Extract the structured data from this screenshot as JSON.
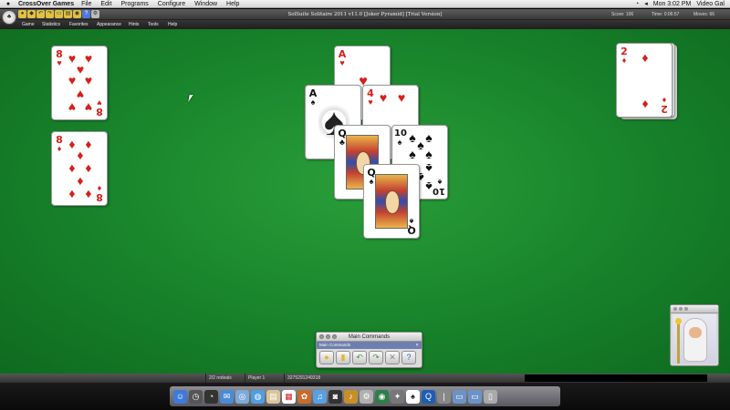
{
  "menubar": {
    "apple": "",
    "app_name": "CrossOver Games",
    "items": [
      "File",
      "Edit",
      "Programs",
      "Configure",
      "Window",
      "Help"
    ],
    "clock": "Mon 3:02 PM",
    "user": "Video Gal"
  },
  "titlebar": {
    "title": "SolSuite Solitaire 2011 v11.0 [Joker Pyramid] [Trial Version]",
    "score": "Score: 106",
    "time": "Time: 0:06:57",
    "moves": "Moves: 66"
  },
  "game_menu": [
    "Game",
    "Statistics",
    "Favorites",
    "Appearance",
    "Hints",
    "Tools",
    "Help"
  ],
  "cards": {
    "eight_hearts": {
      "rank": "8",
      "suit": "♥"
    },
    "eight_diamonds": {
      "rank": "8",
      "suit": "♦"
    },
    "ace_hearts": {
      "rank": "A",
      "suit": "♥"
    },
    "ace_spades": {
      "rank": "A",
      "suit": "♠"
    },
    "four_hearts": {
      "rank": "4",
      "suit": "♥"
    },
    "queen_clubs": {
      "rank": "Q",
      "suit": "♣"
    },
    "ten_spades": {
      "rank": "10",
      "suit": "♠"
    },
    "queen_spades": {
      "rank": "Q",
      "suit": "♠"
    },
    "two_diamonds": {
      "rank": "2",
      "suit": "♦"
    }
  },
  "palette": {
    "title": "Main Commands",
    "subtitle": "Main Commands",
    "close": "✕"
  },
  "status": {
    "redeals": "2/2 redeals",
    "player": "Player 1",
    "seed": "3275291249318"
  },
  "colors": {
    "felt": "#17822a",
    "red_suit": "#d6201c"
  }
}
